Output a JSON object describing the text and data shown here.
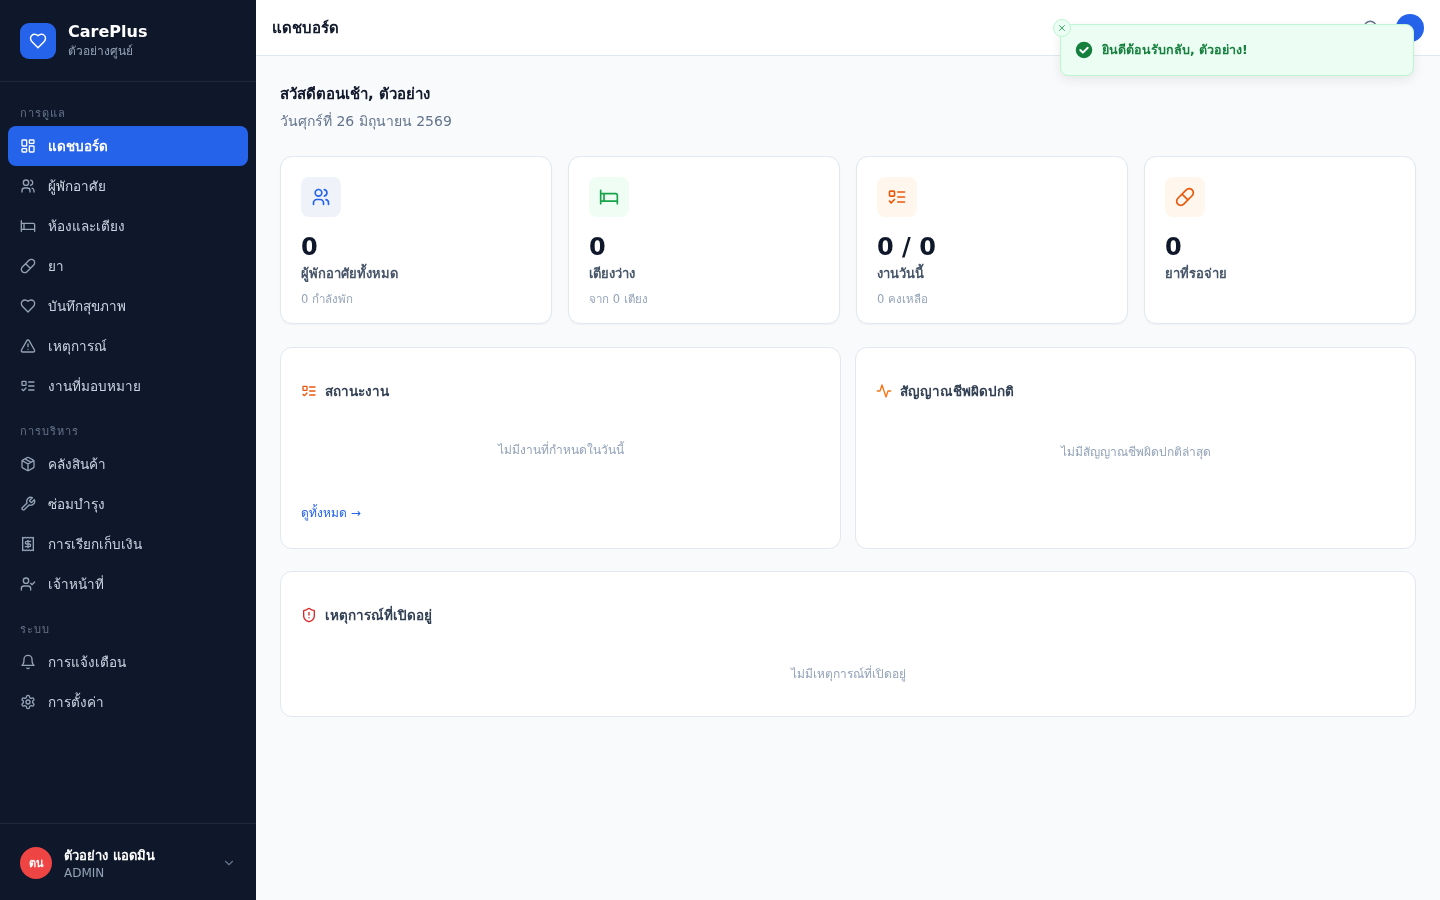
{
  "sidebar": {
    "brand": {
      "name": "CarePlus",
      "subtitle": "ตัวอย่างศูนย์"
    },
    "sections": [
      {
        "title": "การดูแล",
        "items": [
          {
            "label": "แดชบอร์ด",
            "kind": "grid",
            "selected": true
          },
          {
            "label": "ผู้พักอาศัย",
            "kind": "people",
            "selected": false
          },
          {
            "label": "ห้องและเตียง",
            "kind": "bed",
            "selected": false
          },
          {
            "label": "ยา",
            "kind": "pill",
            "selected": false
          },
          {
            "label": "บันทึกสุขภาพ",
            "kind": "heart",
            "selected": false
          },
          {
            "label": "เหตุการณ์",
            "kind": "warning",
            "selected": false
          },
          {
            "label": "งานที่มอบหมาย",
            "kind": "checklist",
            "selected": false
          }
        ]
      },
      {
        "title": "การบริหาร",
        "items": [
          {
            "label": "คลังสินค้า",
            "kind": "box",
            "selected": false
          },
          {
            "label": "ซ่อมบำรุง",
            "kind": "wrench",
            "selected": false
          },
          {
            "label": "การเรียกเก็บเงิน",
            "kind": "receipt",
            "selected": false
          },
          {
            "label": "เจ้าหน้าที่",
            "kind": "personcheck",
            "selected": false
          }
        ]
      },
      {
        "title": "ระบบ",
        "items": [
          {
            "label": "การแจ้งเตือน",
            "kind": "bell",
            "selected": false
          },
          {
            "label": "การตั้งค่า",
            "kind": "settings",
            "selected": false
          }
        ]
      }
    ],
    "user": {
      "initials": "ตน",
      "name": "ตัวอย่าง แอดมิน",
      "role": "ADMIN"
    }
  },
  "header": {
    "title": "แดชบอร์ด"
  },
  "toast": {
    "message": "ยินดีต้อนรับกลับ, ตัวอย่าง!"
  },
  "greeting": "สวัสดีตอนเช้า, ตัวอย่าง",
  "date": "วันศุกร์ที่ 26 มิถุนายน 2569",
  "stats": [
    {
      "kind": "people",
      "value": "0",
      "label": "ผู้พักอาศัยทั้งหมด",
      "sub": "0 กำลังพัก"
    },
    {
      "kind": "bed",
      "value": "0",
      "label": "เตียงว่าง",
      "sub": "จาก 0 เตียง"
    },
    {
      "kind": "checklist",
      "value": "0 / 0",
      "label": "งานวันนี้",
      "sub": "0 คงเหลือ"
    },
    {
      "kind": "pill",
      "value": "0",
      "label": "ยาที่รอจ่าย"
    }
  ],
  "panels": [
    {
      "kind": "checklist",
      "title": "สถานะงาน",
      "empty": "ไม่มีงานที่กำหนดในวันนี้",
      "link": "ดูทั้งหมด →"
    },
    {
      "kind": "pulse",
      "title": "สัญญาณชีพผิดปกติ",
      "empty": "ไม่มีสัญญาณชีพผิดปกติล่าสุด"
    },
    {
      "kind": "shield",
      "title": "เหตุการณ์ที่เปิดอยู่",
      "empty": "ไม่มีเหตุการณ์ที่เปิดอยู่"
    }
  ]
}
